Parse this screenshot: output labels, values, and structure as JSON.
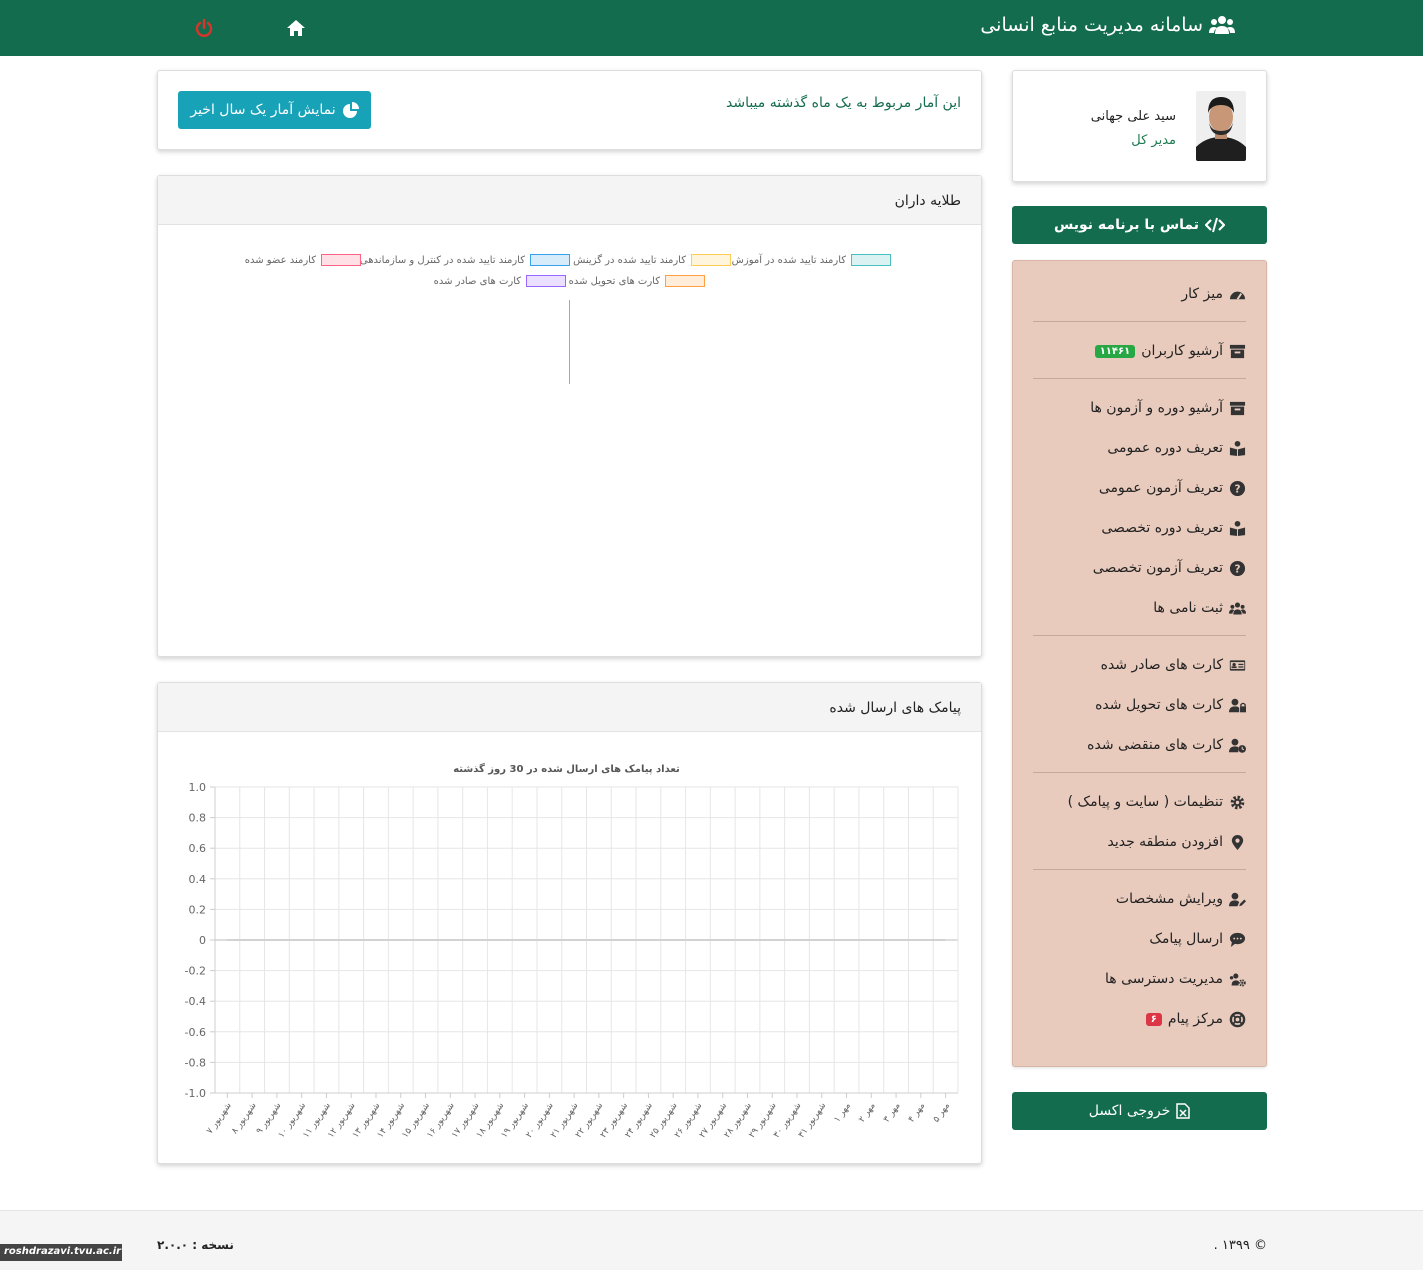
{
  "header": {
    "app_title": "سامانه مدیریت منابع انسانی",
    "brand_icon": "users-icon",
    "home_icon": "home-icon",
    "power_icon": "power-icon"
  },
  "profile": {
    "name": "سید علی جهانی",
    "role": "مدیر کل"
  },
  "buttons": {
    "contact_developer": "تماس با برنامه نویس",
    "excel_export": "خروجی اکسل",
    "show_year_stats": "نمایش آمار یک سال اخیر"
  },
  "menu": {
    "items": [
      {
        "label": "میز کار",
        "icon": "dashboard-icon"
      },
      {
        "label": "آرشیو کاربران",
        "icon": "archive-icon",
        "badge": "۱۱۴۶۱"
      },
      {
        "label": "آرشیو دوره و آزمون ها",
        "icon": "archive-icon"
      },
      {
        "label": "تعریف دوره عمومی",
        "icon": "book-reader-icon"
      },
      {
        "label": "تعریف آزمون عمومی",
        "icon": "question-circle-icon"
      },
      {
        "label": "تعریف دوره تخصصی",
        "icon": "book-reader-icon"
      },
      {
        "label": "تعریف آزمون تخصصی",
        "icon": "question-circle-icon"
      },
      {
        "label": "ثبت نامی ها",
        "icon": "users-icon"
      },
      {
        "label": "کارت های صادر شده",
        "icon": "id-card-icon"
      },
      {
        "label": "کارت های تحویل شده",
        "icon": "user-lock-icon"
      },
      {
        "label": "کارت های منقضی شده",
        "icon": "user-clock-icon"
      },
      {
        "label": "تنظیمات ( سایت و پیامک )",
        "icon": "gear-icon"
      },
      {
        "label": "افزودن منطقه جدید",
        "icon": "map-marker-icon"
      },
      {
        "label": "ویرایش مشخصات",
        "icon": "user-edit-icon"
      },
      {
        "label": "ارسال پیامک",
        "icon": "sms-icon"
      },
      {
        "label": "مدیریت دسترسی ها",
        "icon": "users-cog-icon"
      },
      {
        "label": "مرکز پیام",
        "icon": "life-ring-icon",
        "badge": "۶"
      }
    ]
  },
  "stats_info": {
    "text": "این آمار مربوط به یک ماه گذشته میباشد"
  },
  "panel_gold": {
    "title": "طلایه داران"
  },
  "panel_sms": {
    "title": "پیامک های ارسال شده"
  },
  "colors": {
    "primary": "#146c4f",
    "teal": "#17a2b8",
    "menu_bg": "#e8cbbd"
  },
  "chart_data": [
    {
      "type": "bar",
      "title": "",
      "legend_position": "top",
      "series": [
        {
          "name": "کارمند تایید شده در آموزش",
          "color": "#4bc0c0",
          "values": []
        },
        {
          "name": "کارمند تایید شده در گزینش",
          "color": "#ffcd56",
          "values": []
        },
        {
          "name": "کارمند تایید شده در کنترل و سازماندهی",
          "color": "#36a2eb",
          "values": []
        },
        {
          "name": "کارمند عضو شده",
          "color": "#ff6384",
          "values": []
        },
        {
          "name": "کارت های تحویل شده",
          "color": "#ff9f40",
          "values": []
        },
        {
          "name": "کارت های صادر شده",
          "color": "#9966ff",
          "values": []
        }
      ]
    },
    {
      "type": "line",
      "title": "تعداد پیامک های ارسال شده در 30 روز گذشته",
      "ylim": [
        -1.0,
        1.0
      ],
      "yticks": [
        "1.0",
        "0.8",
        "0.6",
        "0.4",
        "0.2",
        "0",
        "-0.2",
        "-0.4",
        "-0.6",
        "-0.8",
        "-1.0"
      ],
      "grid": true,
      "categories": [
        "۷ شهریور",
        "۸ شهریور",
        "۹ شهریور",
        "۱۰ شهریور",
        "۱۱ شهریور",
        "۱۲ شهریور",
        "۱۳ شهریور",
        "۱۴ شهریور",
        "۱۵ شهریور",
        "۱۶ شهریور",
        "۱۷ شهریور",
        "۱۸ شهریور",
        "۱۹ شهریور",
        "۲۰ شهریور",
        "۲۱ شهریور",
        "۲۲ شهریور",
        "۲۳ شهریور",
        "۲۴ شهریور",
        "۲۵ شهریور",
        "۲۶ شهریور",
        "۲۷ شهریور",
        "۲۸ شهریور",
        "۲۹ شهریور",
        "۳۰ شهریور",
        "۳۱ شهریور",
        "۱ مهر",
        "۲ مهر",
        "۳ مهر",
        "۴ مهر",
        "۵ مهر"
      ],
      "series": [
        {
          "values": [
            0,
            0,
            0,
            0,
            0,
            0,
            0,
            0,
            0,
            0,
            0,
            0,
            0,
            0,
            0,
            0,
            0,
            0,
            0,
            0,
            0,
            0,
            0,
            0,
            0,
            0,
            0,
            0,
            0,
            0
          ]
        }
      ]
    }
  ],
  "footer": {
    "copyright": "© ۱۳۹۹ .",
    "version": "نسخه : ۲.۰.۰"
  },
  "watermark": "roshdrazavi.tvu.ac.ir"
}
